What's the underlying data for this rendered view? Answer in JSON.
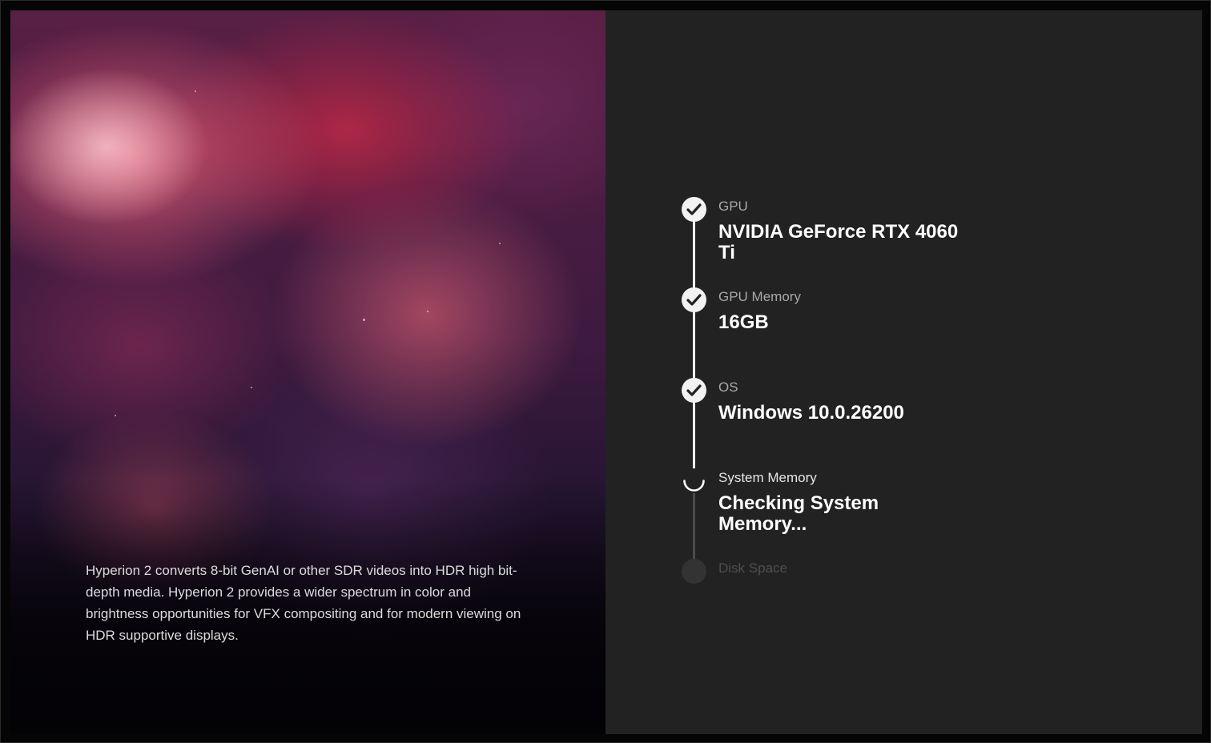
{
  "description": "Hyperion 2 converts 8-bit GenAI or other SDR videos into HDR high bit-depth media. Hyperion 2 provides a wider spectrum in color and brightness opportunities for VFX compositing and for modern viewing on HDR supportive displays.",
  "steps": [
    {
      "label": "GPU",
      "value": "NVIDIA GeForce RTX 4060 Ti",
      "status": "done",
      "icon": "check-icon"
    },
    {
      "label": "GPU Memory",
      "value": "16GB",
      "status": "done",
      "icon": "check-icon"
    },
    {
      "label": "OS",
      "value": "Windows 10.0.26200",
      "status": "done",
      "icon": "check-icon"
    },
    {
      "label": "System Memory",
      "value": "Checking System Memory...",
      "status": "in-progress",
      "icon": "spinner-icon"
    },
    {
      "label": "Disk Space",
      "value": "",
      "status": "pending",
      "icon": "pending-dot-icon"
    }
  ],
  "colors": {
    "panel_background": "#222222",
    "done_marker": "#f2f2f2",
    "pending_marker": "#333333",
    "completed_line": "#ffffff",
    "pending_line": "#4a4a4a"
  }
}
